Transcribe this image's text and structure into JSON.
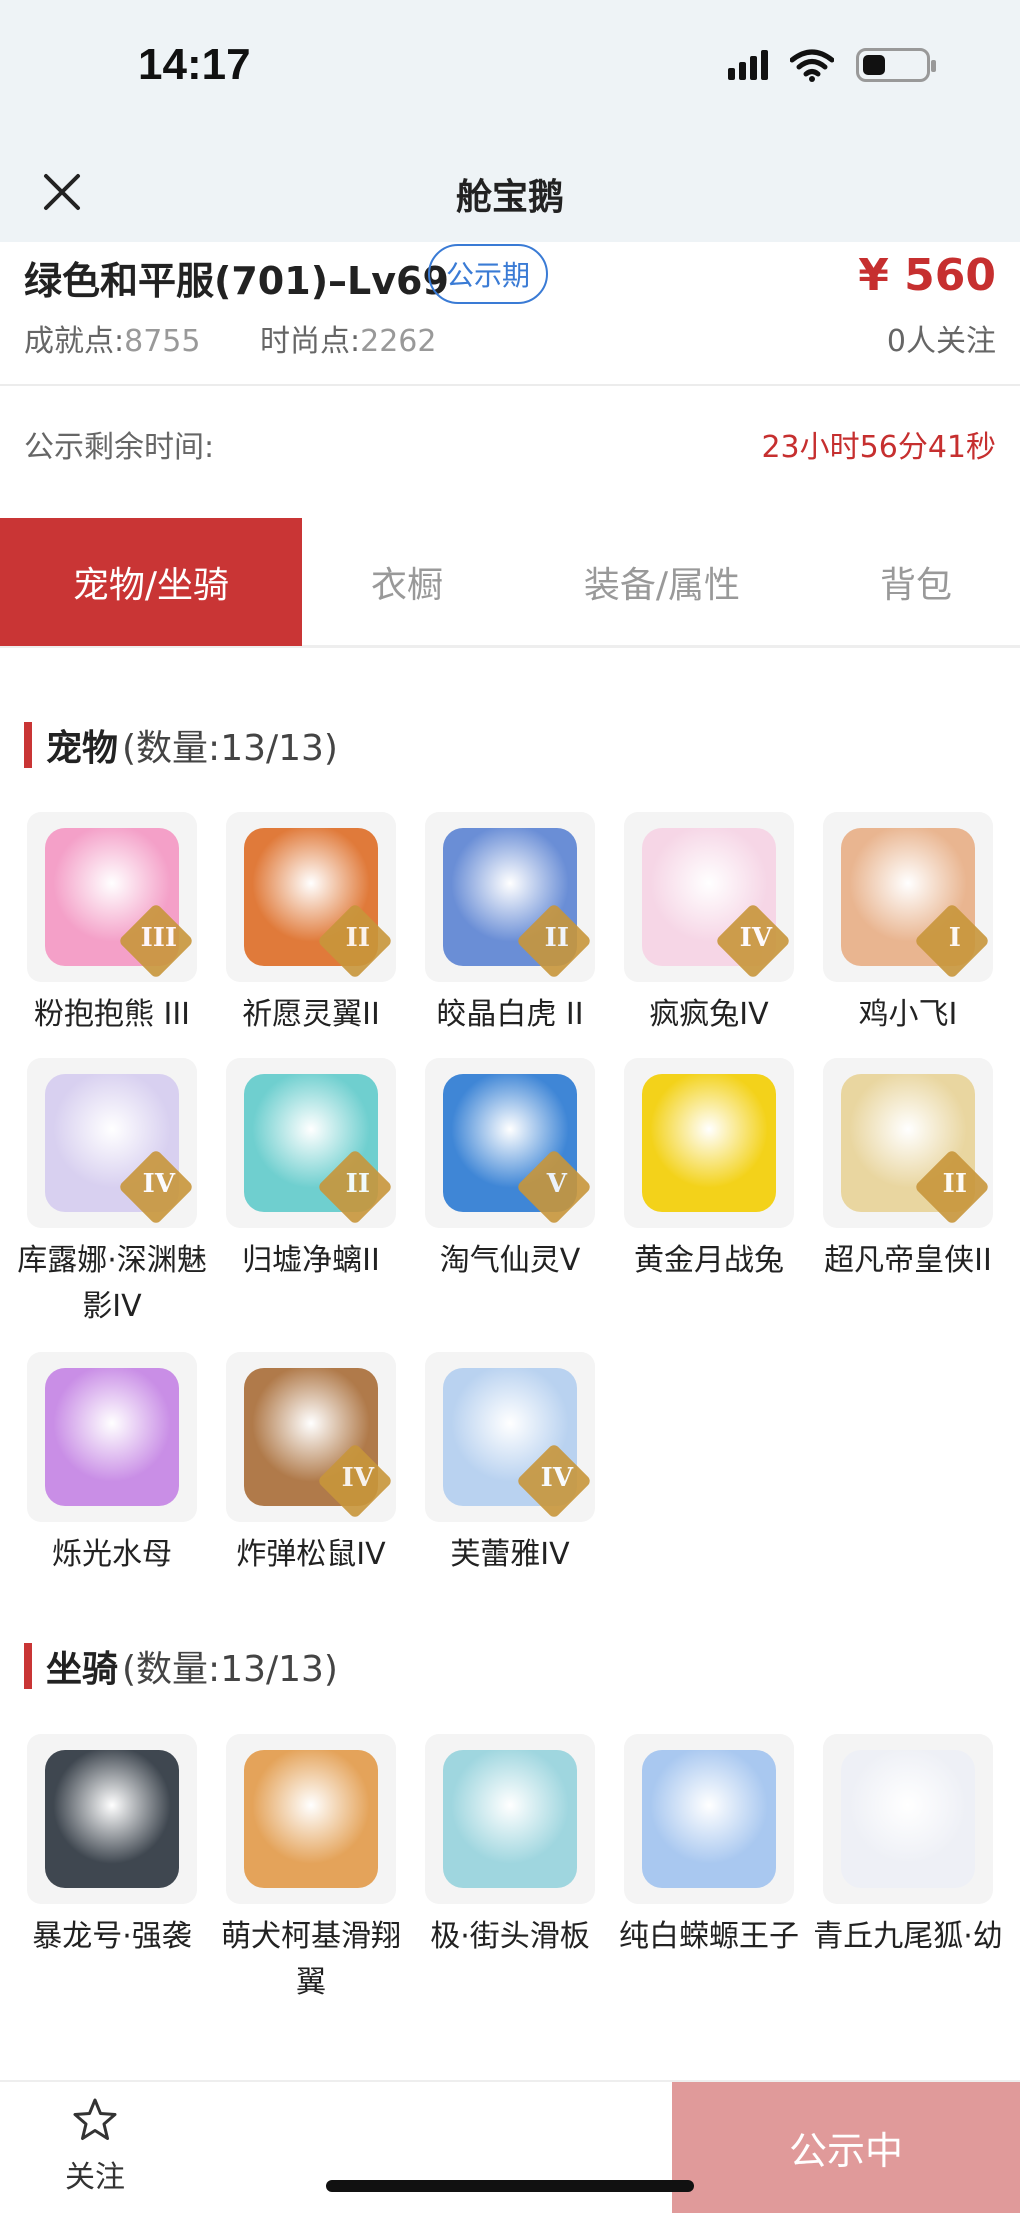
{
  "status": {
    "time": "14:17"
  },
  "nav": {
    "title": "舱宝鹅"
  },
  "header": {
    "title": "绿色和平服(701)–Lv69",
    "badge": "公示期",
    "price": "¥ 560",
    "achievement_label": "成就点:",
    "achievement_value": "8755",
    "fashion_label": "时尚点:",
    "fashion_value": "2262",
    "followers": "0人关注"
  },
  "timer": {
    "label": "公示剩余时间:",
    "value": "23小时56分41秒"
  },
  "tabs": [
    {
      "label": "宠物/坐骑",
      "active": true
    },
    {
      "label": "衣橱"
    },
    {
      "label": "装备/属性"
    },
    {
      "label": "背包"
    }
  ],
  "pets": {
    "title": "宠物",
    "count": "(数量:13/13)",
    "items": [
      {
        "name": "粉抱抱熊 III",
        "rank": "III",
        "color": "#f4a0c8"
      },
      {
        "name": "祈愿灵翼II",
        "rank": "II",
        "color": "#e07a3a"
      },
      {
        "name": "皎晶白虎 II",
        "rank": "II",
        "color": "#6a8ed6"
      },
      {
        "name": "疯疯兔IV",
        "rank": "IV",
        "color": "#f6d6e6"
      },
      {
        "name": "鸡小飞I",
        "rank": "I",
        "color": "#e9b590"
      },
      {
        "name": "库露娜·深渊魅影IV",
        "rank": "IV",
        "color": "#d8d0f0"
      },
      {
        "name": "归墟净螭II",
        "rank": "II",
        "color": "#6fcfcf"
      },
      {
        "name": "淘气仙灵V",
        "rank": "V",
        "color": "#3f86d6"
      },
      {
        "name": "黄金月战兔",
        "rank": "",
        "color": "#f3d21a"
      },
      {
        "name": "超凡帝皇侠II",
        "rank": "II",
        "color": "#e9d6a0"
      },
      {
        "name": "烁光水母",
        "rank": "",
        "color": "#c98ee6"
      },
      {
        "name": "炸弹松鼠IV",
        "rank": "IV",
        "color": "#b07a4a"
      },
      {
        "name": "芙蕾雅IV",
        "rank": "IV",
        "color": "#b9d2f0"
      }
    ]
  },
  "mounts": {
    "title": "坐骑",
    "count": "(数量:13/13)",
    "items": [
      {
        "name": "暴龙号·强袭",
        "color": "#3f4750"
      },
      {
        "name": "萌犬柯基滑翔翼",
        "color": "#e4a35a"
      },
      {
        "name": "极·街头滑板",
        "color": "#9fd6df"
      },
      {
        "name": "纯白蝾螈王子",
        "color": "#a9c8f0"
      },
      {
        "name": "青丘九尾狐·幼",
        "color": "#eef0f6"
      }
    ]
  },
  "bottom": {
    "follow_label": "关注",
    "status_label": "公示中"
  },
  "colors": {
    "accent": "#c93535",
    "price": "#c62f2f",
    "badge": "#3a7bd5",
    "status_button": "#e09a9a"
  }
}
